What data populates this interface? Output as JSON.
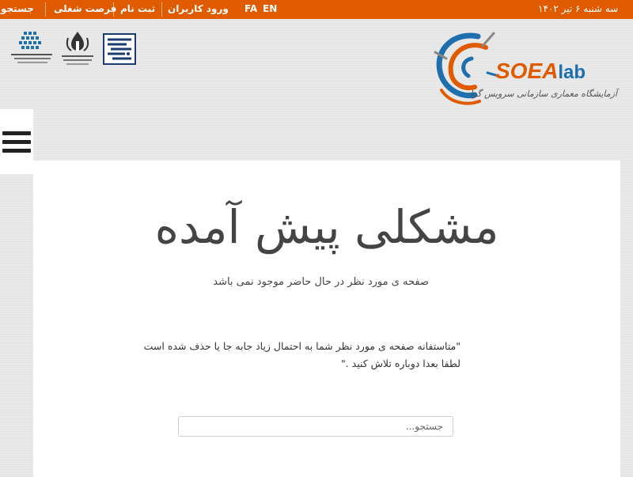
{
  "topbar": {
    "date": "سه شنبه ۶ تیر ۱۴۰۲",
    "lang_en": "EN",
    "lang_fa": "FA",
    "nav": [
      {
        "label": "ورود کاربران"
      },
      {
        "label": "ثبت نام"
      },
      {
        "label": "فرصت شغلی"
      },
      {
        "label": "جستجو"
      }
    ]
  },
  "logos": {
    "soea_brand": "SOEA",
    "soea_lab": "lab",
    "soea_subtitle": "آزمایشگاه معماری سازمانی سرویس گرا"
  },
  "main": {
    "title": "مشکلی پیش آمده",
    "subtitle": "صفحه ی مورد نظر در حال حاضر موجود نمی باشد",
    "message_line1": "\"متاستفانه صفحه ی مورد نظر شما به احتمال زیاد جابه جا یا حذف شده است",
    "message_line2": "لطفا بعدا دوباره تلاش کنید .\"",
    "search_placeholder": "جستجو..."
  },
  "colors": {
    "topbar": "#e05a00",
    "accent_blue": "#1e6fae"
  }
}
